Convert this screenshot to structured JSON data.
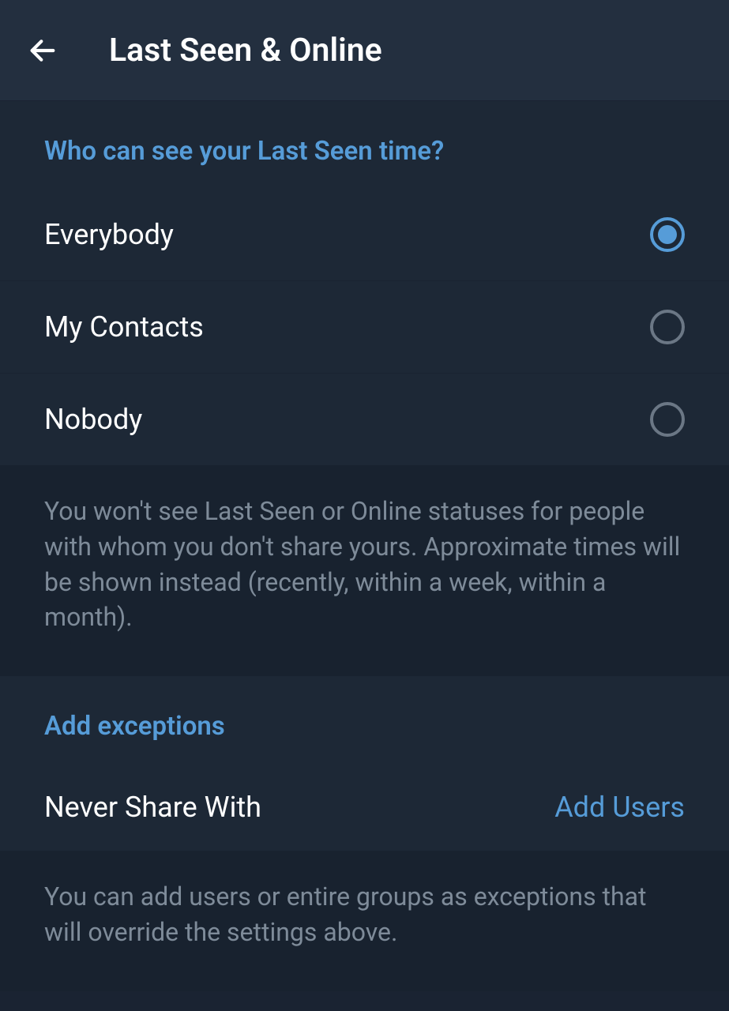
{
  "header": {
    "title": "Last Seen & Online"
  },
  "who_can_see": {
    "title": "Who can see your Last Seen time?",
    "options": [
      {
        "label": "Everybody",
        "selected": true
      },
      {
        "label": "My Contacts",
        "selected": false
      },
      {
        "label": "Nobody",
        "selected": false
      }
    ],
    "info": "You won't see Last Seen or Online statuses for people with whom you don't share yours. Approximate times will be shown instead (recently, within a week, within a month)."
  },
  "exceptions": {
    "title": "Add exceptions",
    "row_label": "Never Share With",
    "row_action": "Add Users",
    "info": "You can add users or entire groups as exceptions that will override the settings above."
  }
}
